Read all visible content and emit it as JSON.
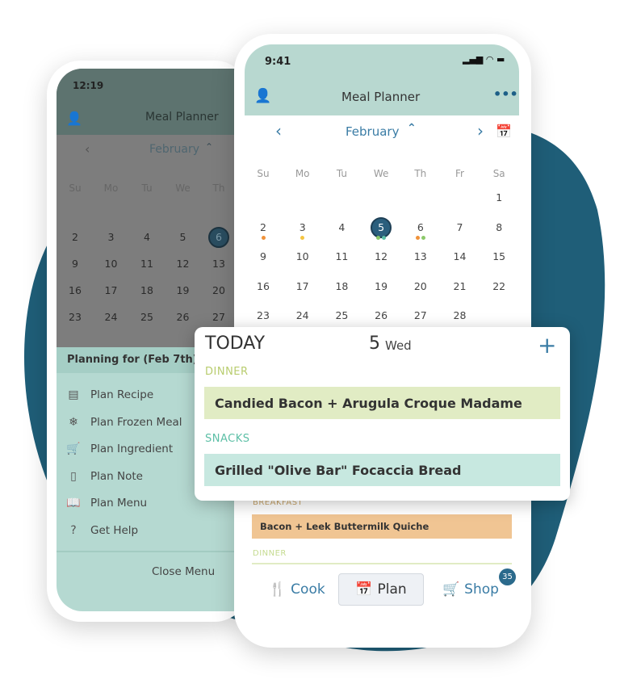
{
  "colors": {
    "blob": "#1f5e78",
    "accent": "#3a7ca5",
    "header": "#b8d8d0",
    "dinner": "#e1ecc4",
    "snacks": "#c7e8e0",
    "breakfast": "#f0c593"
  },
  "back_phone": {
    "time": "12:19",
    "title": "Meal Planner",
    "month": "February",
    "weekdays": [
      "Su",
      "Mo",
      "Tu",
      "We",
      "Th"
    ],
    "weeks": [
      [
        "2",
        "3",
        "4",
        "5",
        "6"
      ],
      [
        "9",
        "10",
        "11",
        "12",
        "13"
      ],
      [
        "16",
        "17",
        "18",
        "19",
        "20"
      ],
      [
        "23",
        "24",
        "25",
        "26",
        "27"
      ]
    ],
    "selected_day": "6",
    "menu": {
      "planning_for": "Planning for (Feb 7th):",
      "items": [
        {
          "icon": "recipe-card-icon",
          "glyph": "▤",
          "label": "Plan Recipe"
        },
        {
          "icon": "snowflake-icon",
          "glyph": "❄",
          "label": "Plan Frozen Meal"
        },
        {
          "icon": "cart-icon",
          "glyph": "🛒",
          "label": "Plan Ingredient"
        },
        {
          "icon": "note-icon",
          "glyph": "▯",
          "label": "Plan Note"
        },
        {
          "icon": "book-icon",
          "glyph": "📖",
          "label": "Plan Menu"
        },
        {
          "icon": "help-icon",
          "glyph": "?",
          "label": "Get Help"
        }
      ],
      "close": "Close Menu"
    }
  },
  "front_phone": {
    "time": "9:41",
    "title": "Meal Planner",
    "month": "February",
    "weekdays": [
      "Su",
      "Mo",
      "Tu",
      "We",
      "Th",
      "Fr",
      "Sa"
    ],
    "weeks": [
      [
        "",
        "",
        "",
        "",
        "",
        "",
        "1"
      ],
      [
        "2",
        "3",
        "4",
        "5",
        "6",
        "7",
        "8"
      ],
      [
        "9",
        "10",
        "11",
        "12",
        "13",
        "14",
        "15"
      ],
      [
        "16",
        "17",
        "18",
        "19",
        "20",
        "21",
        "22"
      ],
      [
        "23",
        "24",
        "25",
        "26",
        "27",
        "28",
        ""
      ]
    ],
    "selected_day": "5",
    "dots": {
      "2": [
        "#f0923a"
      ],
      "3": [
        "#f5c542"
      ],
      "5": [
        "#8cc96a",
        "#5cbfa6"
      ],
      "6": [
        "#f0923a",
        "#8cc96a"
      ]
    },
    "breakfast_label": "BREAKFAST",
    "breakfast_meal": "Bacon + Leek Buttermilk Quiche",
    "dinner_label": "DINNER",
    "tabs": [
      {
        "label": "Cook",
        "icon": "utensils-icon"
      },
      {
        "label": "Plan",
        "icon": "calendar-icon",
        "active": true
      },
      {
        "label": "Shop",
        "icon": "cart-icon",
        "badge": "35"
      }
    ]
  },
  "today_card": {
    "title": "TODAY",
    "day_num": "5",
    "day_name": "Wed",
    "add": "+",
    "sections": [
      {
        "label": "DINNER",
        "meal": "Candied Bacon + Arugula Croque Madame"
      },
      {
        "label": "SNACKS",
        "meal": "Grilled \"Olive Bar\" Focaccia Bread"
      }
    ]
  }
}
